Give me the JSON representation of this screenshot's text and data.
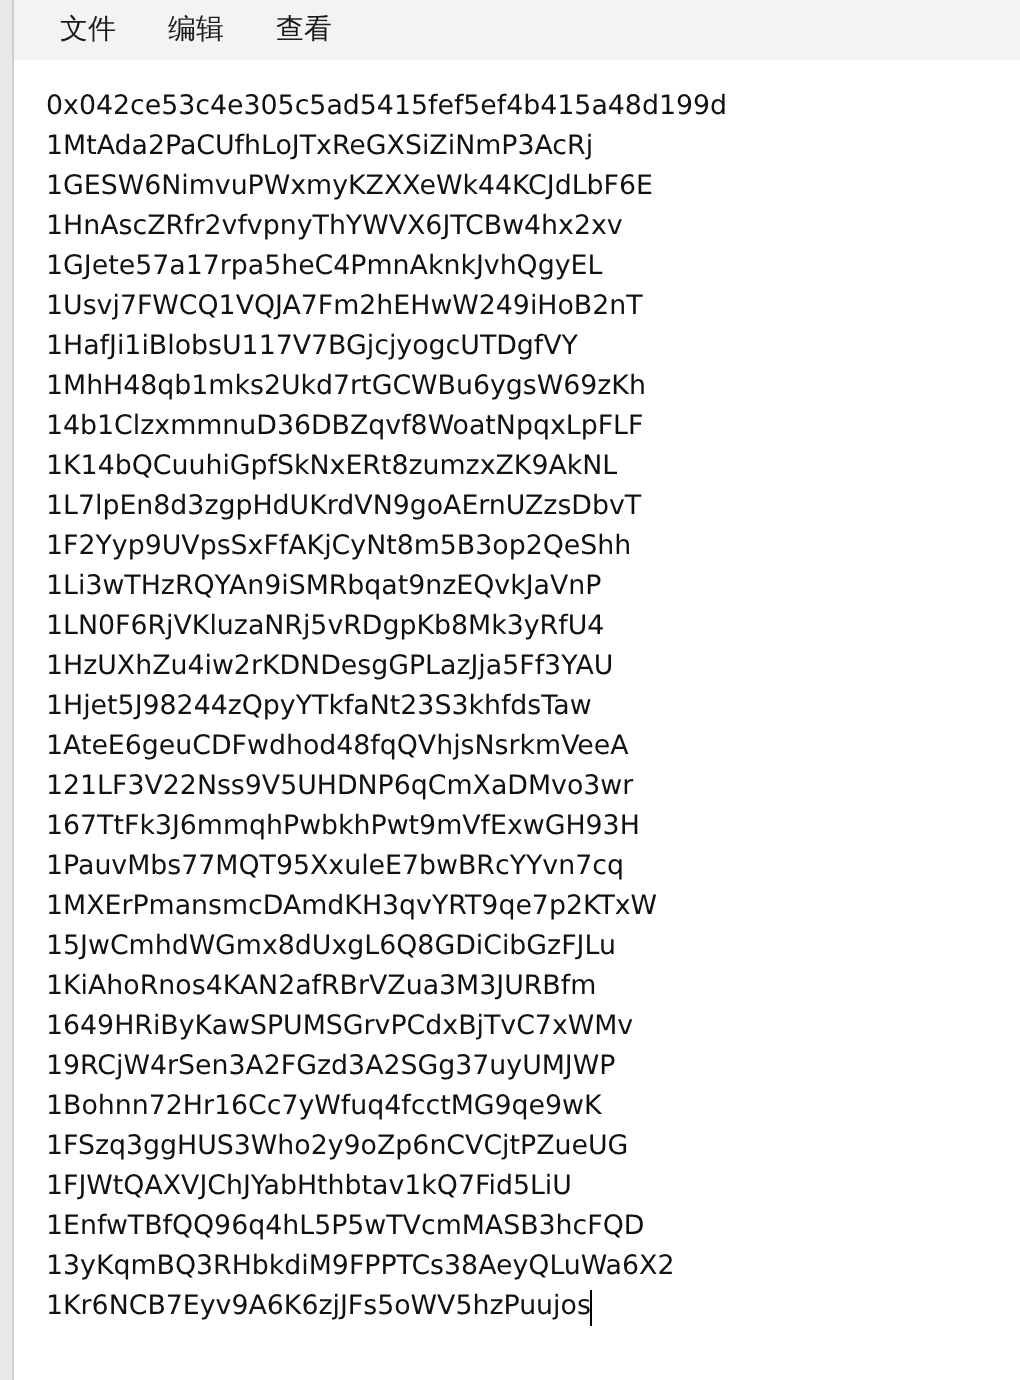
{
  "menu": [
    {
      "label": "文件"
    },
    {
      "label": "编辑"
    },
    {
      "label": "查看"
    }
  ],
  "editor": {
    "cursor_visible": true,
    "lines": [
      "0x042ce53c4e305c5ad5415fef5ef4b415a48d199d",
      "1MtAda2PaCUfhLoJTxReGXSiZiNmP3AcRj",
      "1GESW6NimvuPWxmyKZXXeWk44KCJdLbF6E",
      "1HnAscZRfr2vfvpnyThYWVX6JTCBw4hx2xv",
      "1GJete57a17rpa5heC4PmnAknkJvhQgyEL",
      "1Usvj7FWCQ1VQJA7Fm2hEHwW249iHoB2nT",
      "1HafJi1iBlobsU117V7BGjcjyogcUTDgfVY",
      "1MhH48qb1mks2Ukd7rtGCWBu6ygsW69zKh",
      "14b1ClzxmmnuD36DBZqvf8WoatNpqxLpFLF",
      "1K14bQCuuhiGpfSkNxERt8zumzxZK9AkNL",
      "1L7lpEn8d3zgpHdUKrdVN9goAErnUZzsDbvT",
      "1F2Yyp9UVpsSxFfAKjCyNt8m5B3op2QeShh",
      "1Li3wTHzRQYAn9iSMRbqat9nzEQvkJaVnP",
      "1LN0F6RjVKluzaNRj5vRDgpKb8Mk3yRfU4",
      "1HzUXhZu4iw2rKDNDesgGPLazJja5Ff3YAU",
      "1Hjet5J98244zQpyYTkfaNt23S3khfdsTaw",
      "1AteE6geuCDFwdhod48fqQVhjsNsrkmVeeA",
      "121LF3V22Nss9V5UHDNP6qCmXaDMvo3wr",
      "167TtFk3J6mmqhPwbkhPwt9mVfExwGH93H",
      "1PauvMbs77MQT95XxuleE7bwBRcYYvn7cq",
      "1MXErPmansmcDAmdKH3qvYRT9qe7p2KTxW",
      "15JwCmhdWGmx8dUxgL6Q8GDiCibGzFJLu",
      "1KiAhoRnos4KAN2afRBrVZua3M3JURBfm",
      "1649HRiByKawSPUMSGrvPCdxBjTvC7xWMv",
      "19RCjW4rSen3A2FGzd3A2SGg37uyUMJWP",
      "1Bohnn72Hr16Cc7yWfuq4fcctMG9qe9wK",
      "1FSzq3ggHUS3Who2y9oZp6nCVCjtPZueUG",
      "1FJWtQAXVJChJYabHthbtav1kQ7Fid5LiU",
      "1EnfwTBfQQ96q4hL5P5wTVcmMASB3hcFQD",
      "13yKqmBQ3RHbkdiM9FPPTCs38AeyQLuWa6X2",
      "1Kr6NCB7Eyv9A6K6zjJFs5oWV5hzPuujos"
    ]
  }
}
